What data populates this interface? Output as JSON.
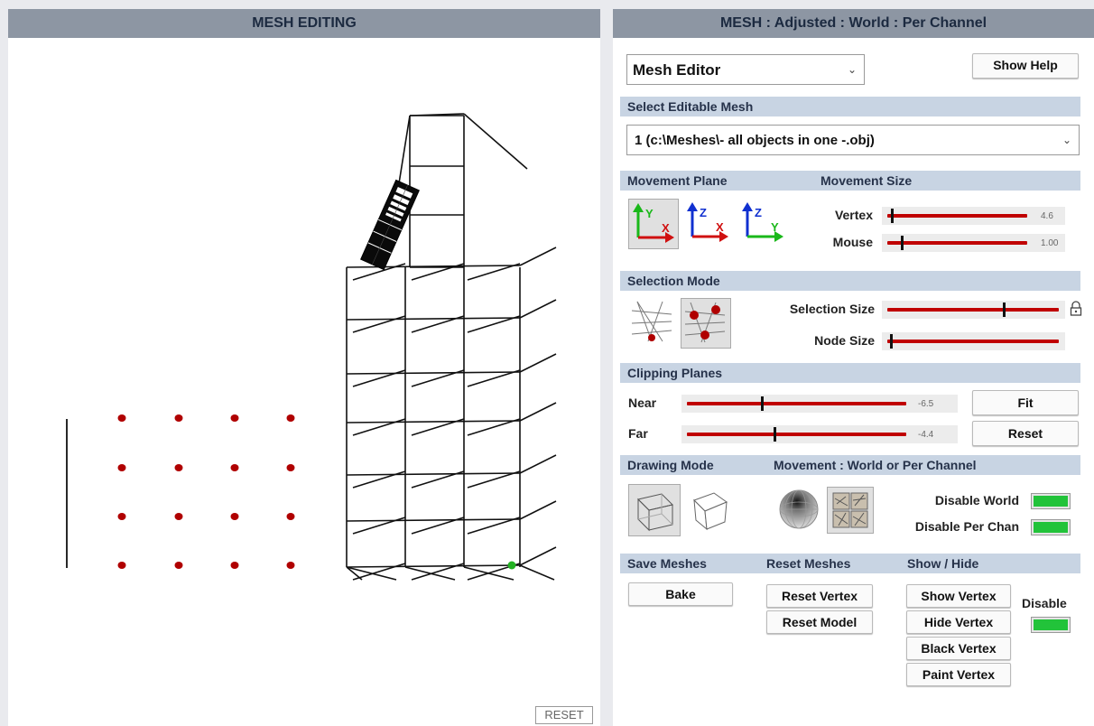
{
  "left": {
    "title": "MESH EDITING",
    "reset_label": "RESET"
  },
  "right": {
    "title": "MESH : Adjusted : World : Per Channel",
    "editor_select": "Mesh Editor",
    "show_help": "Show Help",
    "select_mesh": {
      "header": "Select Editable Mesh",
      "value": "1 (c:\\Meshes\\- all objects in one -.obj)"
    },
    "movement": {
      "plane_header": "Movement Plane",
      "size_header": "Movement Size",
      "planes": [
        {
          "a": "Y",
          "b": "X"
        },
        {
          "a": "Z",
          "b": "X"
        },
        {
          "a": "Z",
          "b": "Y"
        }
      ],
      "vertex_label": "Vertex",
      "vertex_value": "4.6",
      "vertex_level": 0.03,
      "mouse_label": "Mouse",
      "mouse_value": "1.00",
      "mouse_level": 0.1
    },
    "selection": {
      "header": "Selection Mode",
      "size_label": "Selection Size",
      "size_level": 0.68,
      "node_label": "Node Size",
      "node_level": 0.02
    },
    "clipping": {
      "header": "Clipping Planes",
      "near_label": "Near",
      "near_value": "-6.5",
      "near_level": 0.34,
      "far_label": "Far",
      "far_value": "-4.4",
      "far_level": 0.4,
      "fit_label": "Fit",
      "reset_label": "Reset"
    },
    "drawing": {
      "header": "Drawing Mode",
      "movement_header": "Movement : World or Per Channel",
      "disable_world": "Disable World",
      "disable_per_chan": "Disable Per Chan"
    },
    "bottom": {
      "save_header": "Save Meshes",
      "reset_header": "Reset Meshes",
      "show_header": "Show / Hide",
      "bake": "Bake",
      "reset_vertex": "Reset Vertex",
      "reset_model": "Reset Model",
      "show_vertex": "Show Vertex",
      "hide_vertex": "Hide Vertex",
      "black_vertex": "Black Vertex",
      "paint_vertex": "Paint Vertex",
      "disable": "Disable"
    }
  },
  "colors": {
    "title_bar": "#8d96a3",
    "section_header": "#c8d4e3",
    "slider": "#c00000",
    "toggle": "#22c33a",
    "vertex": "#b00000",
    "selected_vertex": "#22b022"
  }
}
